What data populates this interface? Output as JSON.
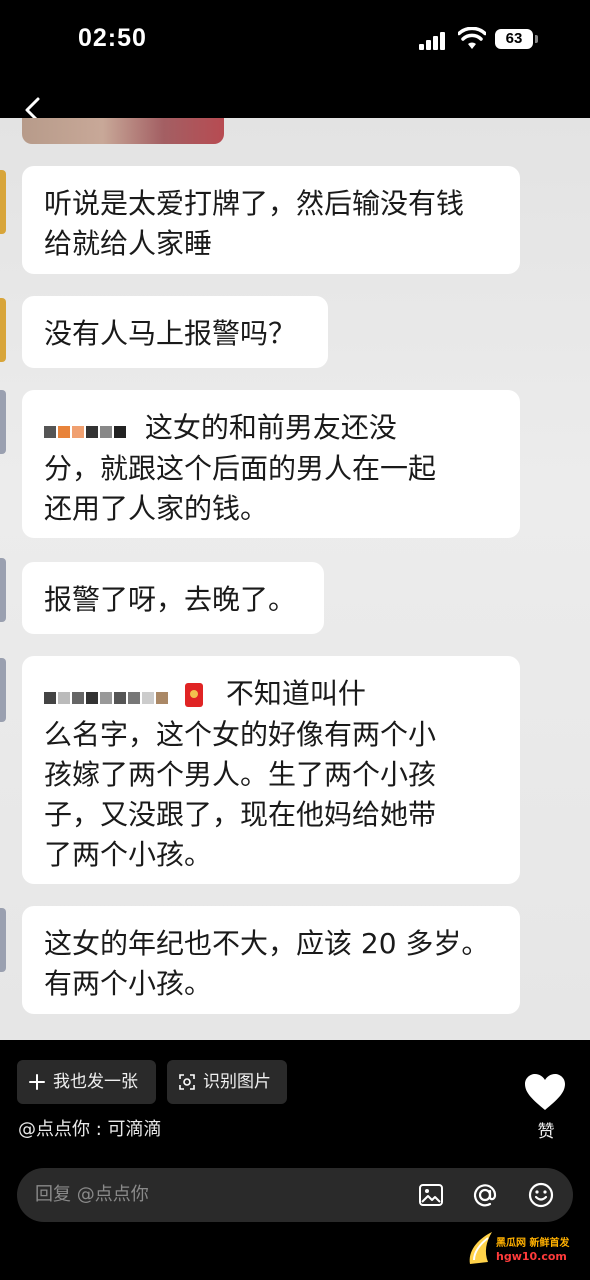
{
  "status_bar": {
    "time": "02:50",
    "battery": "63"
  },
  "messages": [
    {
      "text": "听说是太爱打牌了，然后输没有钱\n给就给人家睡"
    },
    {
      "text": "没有人马上报警吗？"
    },
    {
      "prefix_redacted": true,
      "line1": "这女的和前男友还没",
      "rest": "分，就跟这个后面的男人在一起\n还用了人家的钱。"
    },
    {
      "text": "报警了呀，去晚了。"
    },
    {
      "prefix_redacted": true,
      "line1": "不知道叫什",
      "rest": "么名字，这个女的好像有两个小\n孩嫁了两个男人。生了两个小孩\n子，又没跟了，现在他妈给她带\n了两个小孩。"
    },
    {
      "text": "这女的年纪也不大，应该 20 多岁。\n有两个小孩。"
    }
  ],
  "actions": {
    "post_too": "我也发一张",
    "recognize_image": "识别图片"
  },
  "author": "@点点你 : 可滴滴",
  "like_label": "赞",
  "reply": {
    "placeholder": "回复 @点点你"
  },
  "icons": [
    "back-icon",
    "plus-icon",
    "scan-icon",
    "heart-icon",
    "image-icon",
    "at-icon",
    "emoji-icon"
  ],
  "watermark": {
    "line1": "黑瓜网 新鲜首发",
    "line2": "hgw10.com"
  }
}
